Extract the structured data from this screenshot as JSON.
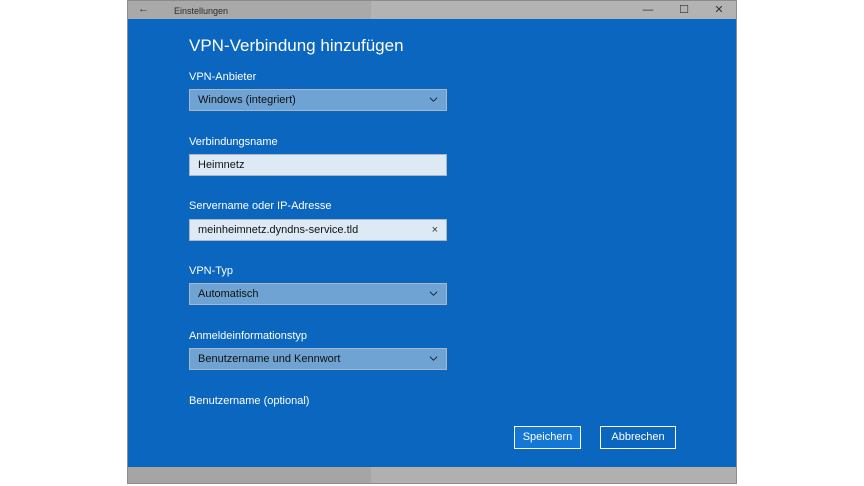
{
  "titlebar": {
    "back_glyph": "←",
    "title": "Einstellungen",
    "minimize_glyph": "—",
    "maximize_glyph": "☐",
    "close_glyph": "✕"
  },
  "dialog": {
    "heading": "VPN-Verbindung hinzufügen",
    "fields": {
      "vpn_provider": {
        "label": "VPN-Anbieter",
        "value": "Windows (integriert)"
      },
      "connection_name": {
        "label": "Verbindungsname",
        "value": "Heimnetz"
      },
      "server": {
        "label": "Servername oder IP-Adresse",
        "value": "meinheimnetz.dyndns-service.tld",
        "clear_glyph": "×"
      },
      "vpn_type": {
        "label": "VPN-Typ",
        "value": "Automatisch"
      },
      "credential_type": {
        "label": "Anmeldeinformationstyp",
        "value": "Benutzername und Kennwort"
      },
      "username": {
        "label": "Benutzername (optional)"
      }
    },
    "buttons": {
      "save": "Speichern",
      "cancel": "Abbrechen"
    }
  },
  "colors": {
    "dialog_bg": "#0b66c0",
    "select_bg": "#6ea3d4",
    "input_bg": "#ddeaf6"
  }
}
